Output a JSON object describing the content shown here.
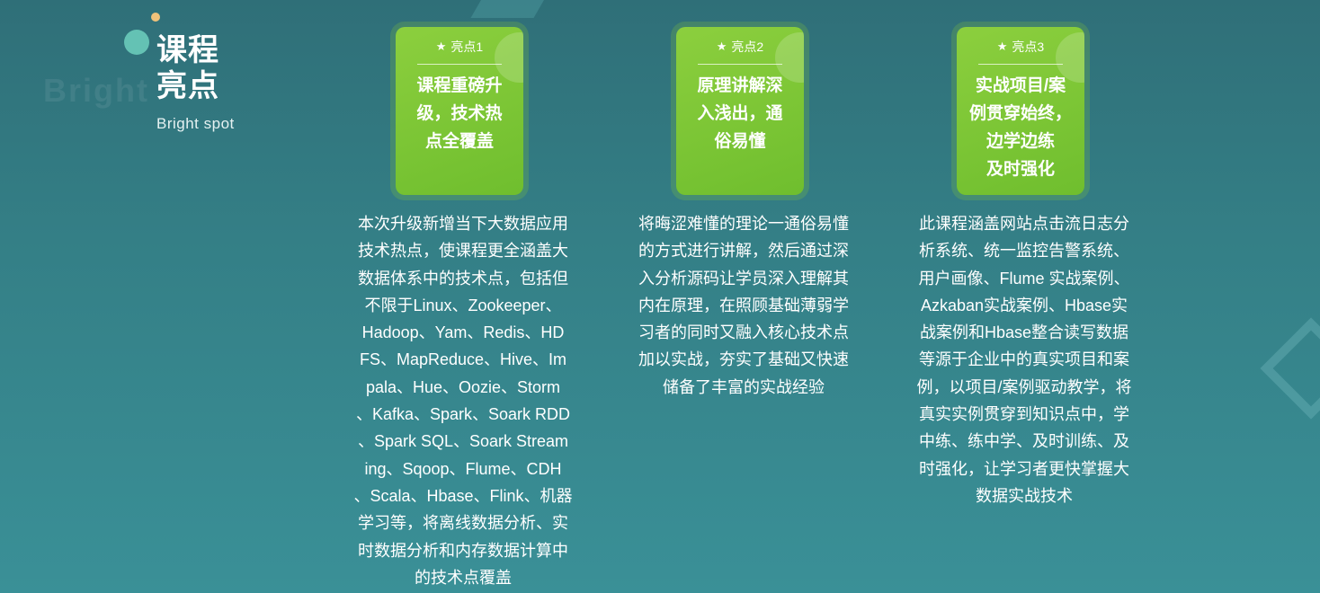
{
  "header": {
    "title": "课程\n亮点",
    "subtitle": "Bright spot",
    "watermark": "Bright"
  },
  "colors": {
    "background_top": "#2f6f78",
    "background_bottom": "#3a9097",
    "card_green": "#7cc436",
    "dot_teal": "#64c2b4",
    "dot_gold": "#f0c27a"
  },
  "highlights": [
    {
      "label": "亮点1",
      "icon": "star-icon",
      "title": "课程重磅升\n级，技术热\n点全覆盖",
      "description": "本次升级新增当下大数据应用\n技术热点，使课程更全涵盖大\n数据体系中的技术点，包括但\n不限于Linux、Zookeeper、\nHadoop、Yam、Redis、HD\nFS、MapReduce、Hive、Im\npala、Hue、Oozie、Storm\n、Kafka、Spark、Soark RDD\n、Spark SQL、Soark Stream\ning、Sqoop、Flume、CDH\n、Scala、Hbase、Flink、机器\n学习等，将离线数据分析、实\n时数据分析和内存数据计算中\n的技术点覆盖"
    },
    {
      "label": "亮点2",
      "icon": "star-icon",
      "title": "原理讲解深\n入浅出，通\n俗易懂",
      "description": "将晦涩难懂的理论一通俗易懂\n的方式进行讲解，然后通过深\n入分析源码让学员深入理解其\n内在原理，在照顾基础薄弱学\n习者的同时又融入核心技术点\n加以实战，夯实了基础又快速\n储备了丰富的实战经验"
    },
    {
      "label": "亮点3",
      "icon": "star-icon",
      "title": "实战项目/案\n例贯穿始终，\n边学边练\n及时强化",
      "description": "此课程涵盖网站点击流日志分\n析系统、统一监控告警系统、\n用户画像、Flume 实战案例、\nAzkaban实战案例、Hbase实\n战案例和Hbase整合读写数据\n等源于企业中的真实项目和案\n例，以项目/案例驱动教学，将\n真实实例贯穿到知识点中，学\n中练、练中学、及时训练、及\n时强化，让学习者更快掌握大\n数据实战技术"
    }
  ]
}
